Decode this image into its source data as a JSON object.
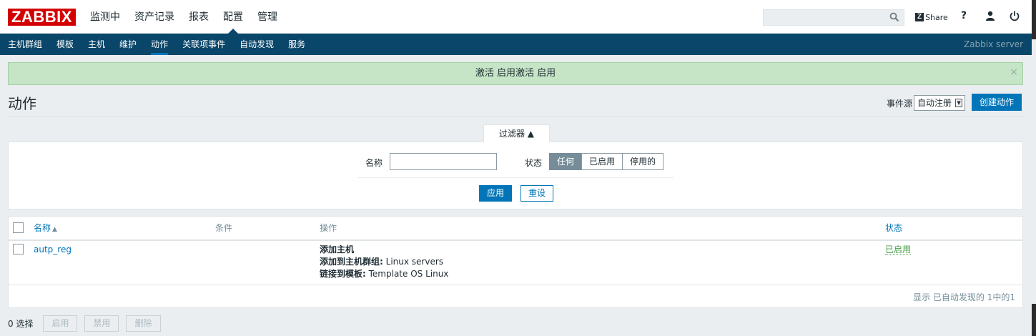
{
  "header": {
    "logo": "ZABBIX",
    "menu": [
      {
        "label": "监测中",
        "active": false
      },
      {
        "label": "资产记录",
        "active": false
      },
      {
        "label": "报表",
        "active": false
      },
      {
        "label": "配置",
        "active": true
      },
      {
        "label": "管理",
        "active": false
      }
    ],
    "search_value": "",
    "share_label": "Share",
    "help_label": "?"
  },
  "submenu": {
    "items": [
      {
        "label": "主机群组",
        "active": false
      },
      {
        "label": "模板",
        "active": false
      },
      {
        "label": "主机",
        "active": false
      },
      {
        "label": "维护",
        "active": false
      },
      {
        "label": "动作",
        "active": true
      },
      {
        "label": "关联项事件",
        "active": false
      },
      {
        "label": "自动发现",
        "active": false
      },
      {
        "label": "服务",
        "active": false
      }
    ],
    "server": "Zabbix server"
  },
  "message": {
    "text": "激活 启用激活 启用",
    "close": "×"
  },
  "page": {
    "title": "动作",
    "event_source_label": "事件源",
    "event_source_value": "自动注册",
    "create_button": "创建动作"
  },
  "filter": {
    "tab_label": "过滤器 ▲",
    "name_label": "名称",
    "name_value": "",
    "status_label": "状态",
    "status_options": [
      {
        "label": "任何",
        "selected": true
      },
      {
        "label": "已启用",
        "selected": false
      },
      {
        "label": "停用的",
        "selected": false
      }
    ],
    "apply": "应用",
    "reset": "重设"
  },
  "table": {
    "columns": {
      "name": "名称",
      "sort_indicator": "▲",
      "conditions": "条件",
      "operations": "操作",
      "status": "状态"
    },
    "rows": [
      {
        "name": "autp_reg",
        "conditions": "",
        "operations": [
          {
            "label": "添加主机",
            "value": ""
          },
          {
            "label": "添加到主机群组:",
            "value": " Linux servers"
          },
          {
            "label": "链接到模板:",
            "value": " Template OS Linux"
          }
        ],
        "status": "已启用"
      }
    ],
    "pager": "显示 已自动发现的 1中的1"
  },
  "footer": {
    "selected": "0 选择",
    "enable": "启用",
    "disable": "禁用",
    "delete": "删除"
  },
  "colors": {
    "brand": "#d40000",
    "navbar": "#0a466a",
    "primary": "#0275b8",
    "success_bg": "#c5e5c6",
    "status_ok": "#429e47"
  }
}
